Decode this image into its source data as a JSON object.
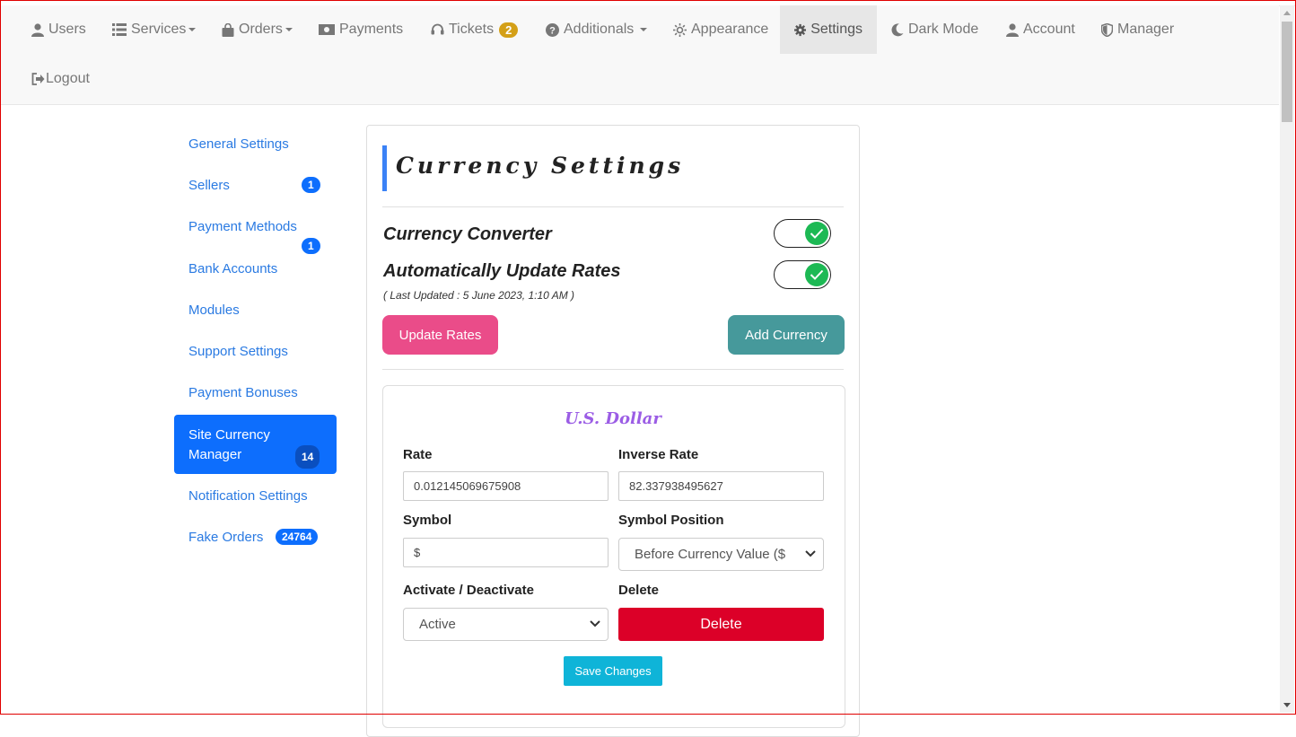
{
  "nav": {
    "users": "Users",
    "services": "Services",
    "orders": "Orders",
    "payments": "Payments",
    "tickets": "Tickets",
    "tickets_badge": "2",
    "additionals": "Additionals",
    "appearance": "Appearance",
    "settings": "Settings",
    "dark_mode": "Dark Mode",
    "account": "Account",
    "manager": "Manager",
    "logout": "Logout"
  },
  "sidebar": {
    "items": [
      {
        "label": "General Settings",
        "badge": ""
      },
      {
        "label": "Sellers",
        "badge": "1"
      },
      {
        "label": "Payment Methods",
        "badge": "1"
      },
      {
        "label": "Bank Accounts",
        "badge": ""
      },
      {
        "label": "Modules",
        "badge": ""
      },
      {
        "label": "Support Settings",
        "badge": ""
      },
      {
        "label": "Payment Bonuses",
        "badge": ""
      },
      {
        "label": "Site Currency Manager",
        "badge": "14"
      },
      {
        "label": "Notification Settings",
        "badge": ""
      },
      {
        "label": "Fake Orders",
        "badge": "24764"
      }
    ]
  },
  "panel": {
    "title": "Currency Settings",
    "currency_converter": "Currency Converter",
    "currency_converter_enabled": true,
    "auto_update": "Automatically Update Rates",
    "auto_update_enabled": true,
    "last_updated": "( Last Updated : 5 June 2023, 1:10 AM )",
    "update_rates_button": "Update Rates",
    "add_currency_button": "Add Currency"
  },
  "currency": {
    "name": "U.S. Dollar",
    "rate_label": "Rate",
    "rate_value": "0.012145069675908",
    "inverse_rate_label": "Inverse Rate",
    "inverse_rate_value": "82.337938495627",
    "symbol_label": "Symbol",
    "symbol_value": "$",
    "symbol_position_label": "Symbol Position",
    "symbol_position_value": "Before Currency Value ($",
    "activate_label": "Activate / Deactivate",
    "activate_value": "Active",
    "delete_label": "Delete",
    "delete_button": "Delete",
    "save_button": "Save Changes"
  },
  "colors": {
    "accent": "#3b82f6",
    "link": "#2a7ae2",
    "active_sidebar": "#0d6efd",
    "update_button": "#ea4c89",
    "add_button": "#46999b",
    "delete_button": "#dc0028",
    "save_button": "#0fb4d8",
    "toggle_on": "#1db954",
    "currency_title": "#9b5de5"
  }
}
